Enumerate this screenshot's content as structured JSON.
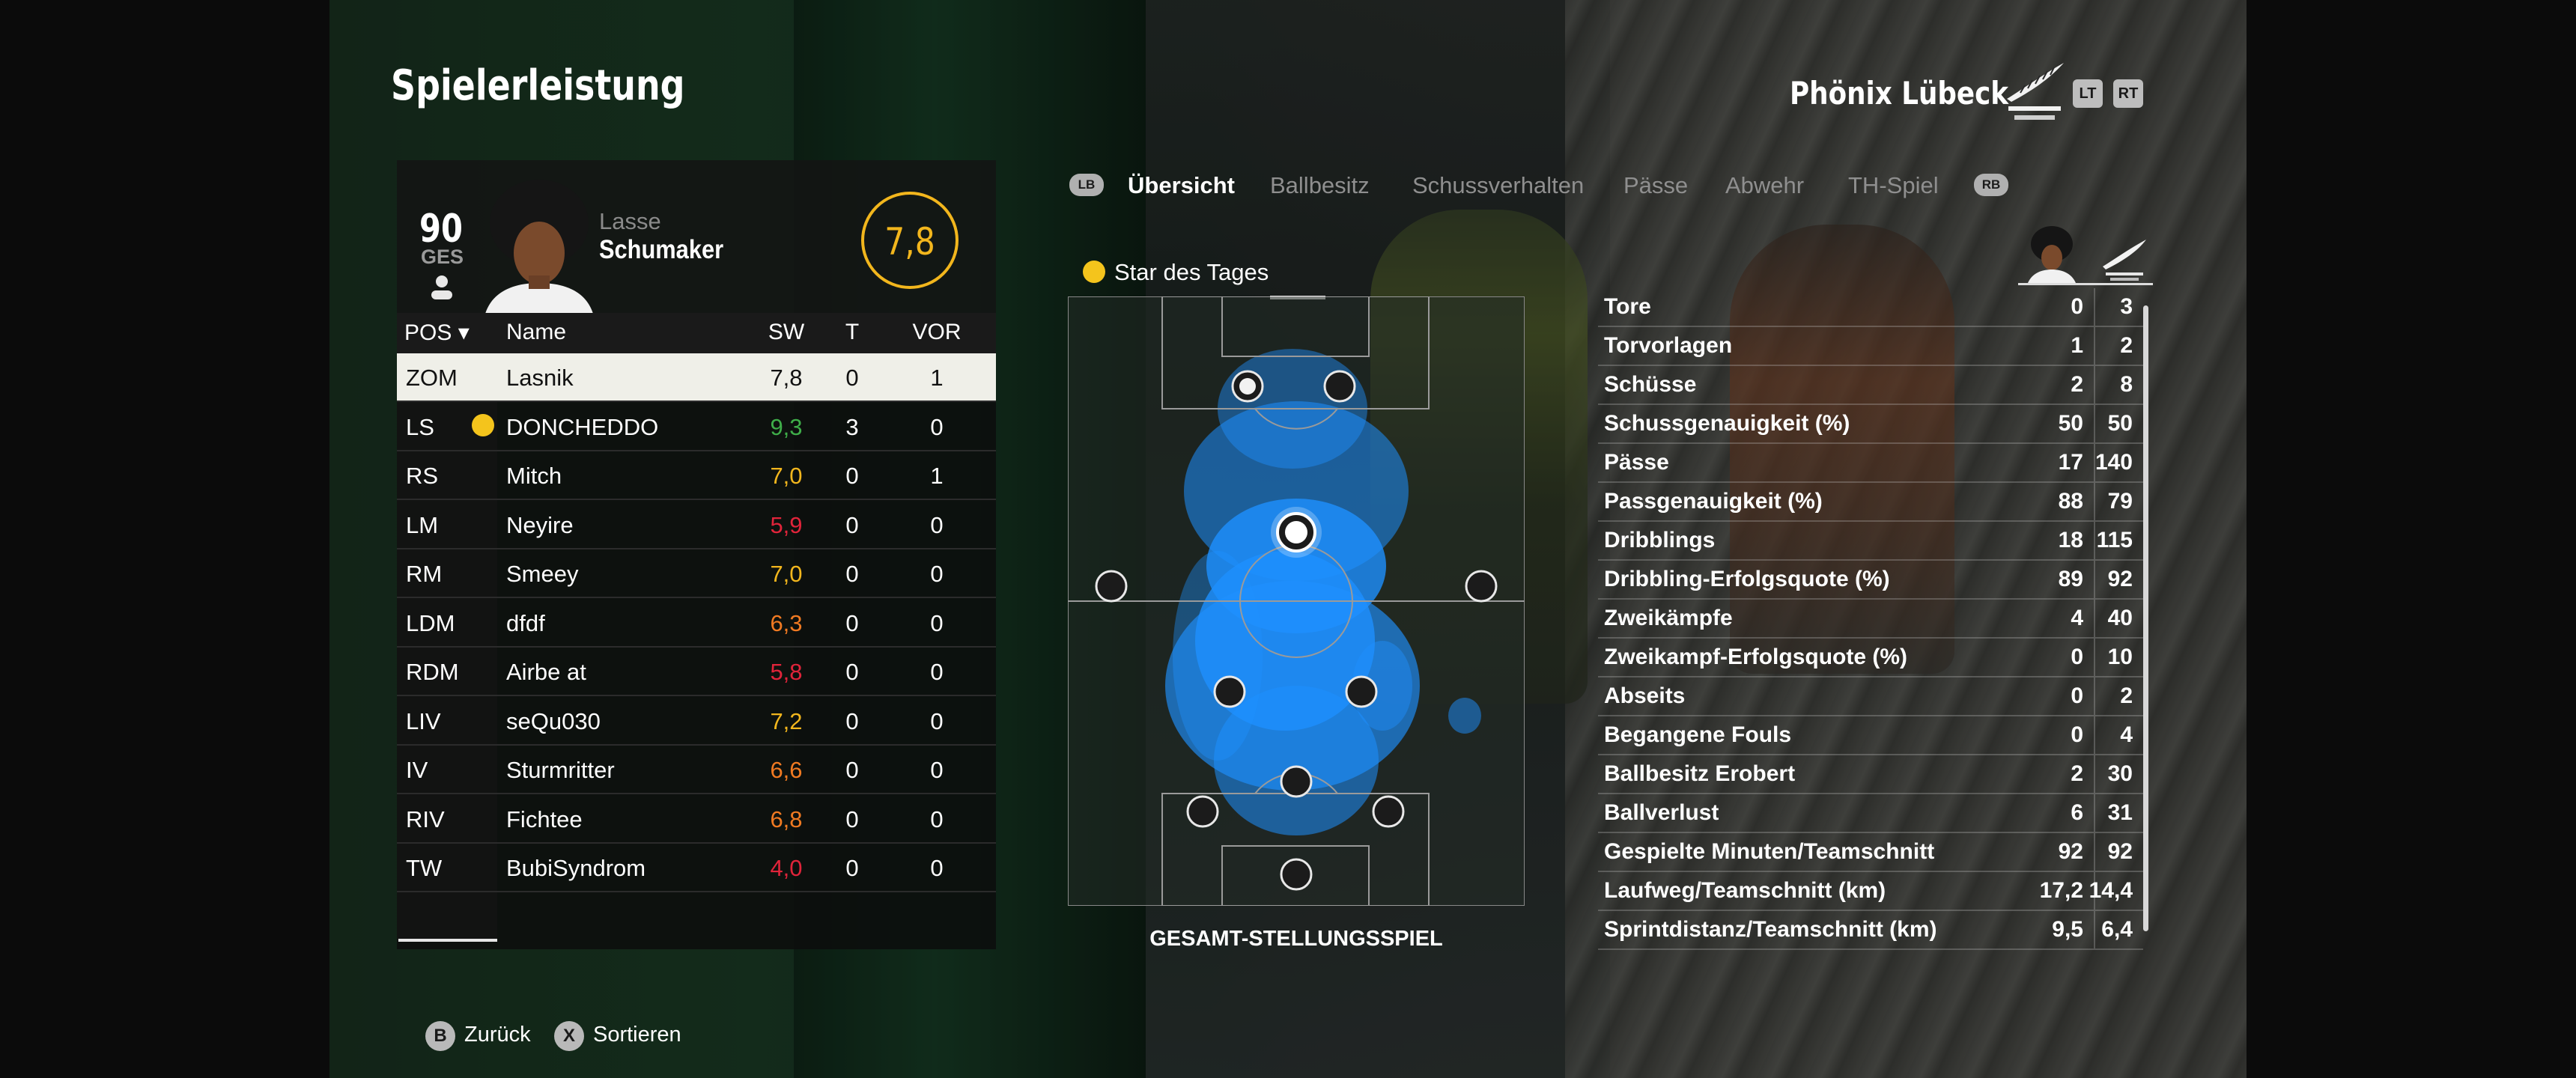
{
  "header": {
    "title": "Spielerleistung",
    "team_name": "Phönix Lübeck",
    "lt": "LT",
    "rt": "RT"
  },
  "player": {
    "overall": "90",
    "overall_label": "GES",
    "first_name": "Lasse",
    "last_name": "Schumaker",
    "rating": "7,8"
  },
  "table": {
    "columns": {
      "pos": "POS",
      "name": "Name",
      "sw": "SW",
      "t": "T",
      "vor": "VOR"
    },
    "rows": [
      {
        "pos": "ZOM",
        "name": "Lasnik",
        "sw": "7,8",
        "t": "0",
        "vor": "1",
        "color": "#111111",
        "selected": true
      },
      {
        "pos": "LS",
        "name": "DONCHEDDO",
        "sw": "9,3",
        "t": "3",
        "vor": "0",
        "color": "#3fae49",
        "star": true
      },
      {
        "pos": "RS",
        "name": "Mitch",
        "sw": "7,0",
        "t": "0",
        "vor": "1",
        "color": "#f2b61d"
      },
      {
        "pos": "LM",
        "name": "Neyire",
        "sw": "5,9",
        "t": "0",
        "vor": "0",
        "color": "#e0243a"
      },
      {
        "pos": "RM",
        "name": "Smeey",
        "sw": "7,0",
        "t": "0",
        "vor": "0",
        "color": "#f2b61d"
      },
      {
        "pos": "LDM",
        "name": "dfdf",
        "sw": "6,3",
        "t": "0",
        "vor": "0",
        "color": "#f07a22"
      },
      {
        "pos": "RDM",
        "name": "Airbe at",
        "sw": "5,8",
        "t": "0",
        "vor": "0",
        "color": "#e0243a"
      },
      {
        "pos": "LIV",
        "name": "seQu030",
        "sw": "7,2",
        "t": "0",
        "vor": "0",
        "color": "#f2b61d"
      },
      {
        "pos": "IV",
        "name": "Sturmritter",
        "sw": "6,6",
        "t": "0",
        "vor": "0",
        "color": "#f07a22"
      },
      {
        "pos": "RIV",
        "name": "Fichtee",
        "sw": "6,8",
        "t": "0",
        "vor": "0",
        "color": "#f07a22"
      },
      {
        "pos": "TW",
        "name": "BubiSyndrom",
        "sw": "4,0",
        "t": "0",
        "vor": "0",
        "color": "#e0243a"
      }
    ]
  },
  "tabs": {
    "lb": "LB",
    "rb": "RB",
    "items": [
      "Übersicht",
      "Ballbesitz",
      "Schussverhalten",
      "Pässe",
      "Abwehr",
      "TH-Spiel"
    ],
    "active": 0
  },
  "pitch": {
    "star_label": "Star des Tages",
    "caption": "GESAMT-STELLUNGSSPIEL"
  },
  "stats": [
    {
      "label": "Tore",
      "player": "0",
      "team": "3"
    },
    {
      "label": "Torvorlagen",
      "player": "1",
      "team": "2"
    },
    {
      "label": "Schüsse",
      "player": "2",
      "team": "8"
    },
    {
      "label": "Schussgenauigkeit (%)",
      "player": "50",
      "team": "50"
    },
    {
      "label": "Pässe",
      "player": "17",
      "team": "140"
    },
    {
      "label": "Passgenauigkeit (%)",
      "player": "88",
      "team": "79"
    },
    {
      "label": "Dribblings",
      "player": "18",
      "team": "115"
    },
    {
      "label": "Dribbling-Erfolgsquote (%)",
      "player": "89",
      "team": "92"
    },
    {
      "label": "Zweikämpfe",
      "player": "4",
      "team": "40"
    },
    {
      "label": "Zweikampf-Erfolgsquote (%)",
      "player": "0",
      "team": "10"
    },
    {
      "label": "Abseits",
      "player": "0",
      "team": "2"
    },
    {
      "label": "Begangene Fouls",
      "player": "0",
      "team": "4"
    },
    {
      "label": "Ballbesitz Erobert",
      "player": "2",
      "team": "30"
    },
    {
      "label": "Ballverlust",
      "player": "6",
      "team": "31"
    },
    {
      "label": "Gespielte Minuten/Teamschnitt",
      "player": "92",
      "team": "92"
    },
    {
      "label": "Laufweg/Teamschnitt (km)",
      "player": "17,2",
      "team": "14,4"
    },
    {
      "label": "Sprintdistanz/Teamschnitt (km)",
      "player": "9,5",
      "team": "6,4"
    }
  ],
  "footer": {
    "back_key": "B",
    "back_label": "Zurück",
    "sort_key": "X",
    "sort_label": "Sortieren"
  },
  "colors": {
    "accent_rating": "#f2b61d",
    "heat": "#1e90ff",
    "good": "#3fae49",
    "bad": "#e0243a",
    "mid": "#f07a22"
  },
  "icons": {
    "player_icon": "person-icon",
    "star_icon": "star-of-day-icon",
    "ball_icon": "ball-icon",
    "team_crest": "fern-crest-icon"
  }
}
